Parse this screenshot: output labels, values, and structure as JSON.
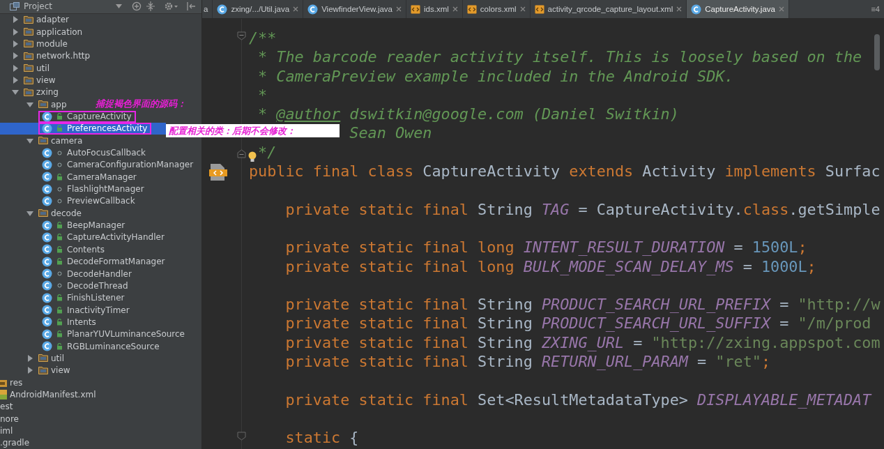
{
  "project_panel": {
    "title": "Project",
    "tree": [
      {
        "label": "adapter",
        "kind": "folder",
        "expanded": false,
        "selected": false
      },
      {
        "label": "application",
        "kind": "folder",
        "expanded": false,
        "selected": false
      },
      {
        "label": "module",
        "kind": "folder",
        "expanded": false,
        "selected": false
      },
      {
        "label": "network.http",
        "kind": "folder",
        "expanded": false,
        "selected": false
      },
      {
        "label": "util",
        "kind": "folder",
        "expanded": false,
        "selected": false
      },
      {
        "label": "view",
        "kind": "folder",
        "expanded": false,
        "selected": false
      },
      {
        "label": "zxing",
        "kind": "folder",
        "expanded": true,
        "selected": false,
        "children": [
          {
            "label": "app",
            "kind": "folder",
            "expanded": true,
            "selected": false,
            "children": [
              {
                "label": "CaptureActivity",
                "kind": "class",
                "public": true,
                "selected": false,
                "highlighted": true
              },
              {
                "label": "PreferencesActivity",
                "kind": "class",
                "public": true,
                "selected": true,
                "highlighted": true
              }
            ]
          },
          {
            "label": "camera",
            "kind": "folder",
            "expanded": true,
            "selected": false,
            "children": [
              {
                "label": "AutoFocusCallback",
                "kind": "class",
                "public": false,
                "selected": false,
                "highlighted": false
              },
              {
                "label": "CameraConfigurationManager",
                "kind": "class",
                "public": false,
                "selected": false,
                "highlighted": false
              },
              {
                "label": "CameraManager",
                "kind": "class",
                "public": true,
                "selected": false,
                "highlighted": false
              },
              {
                "label": "FlashlightManager",
                "kind": "class",
                "public": false,
                "selected": false,
                "highlighted": false
              },
              {
                "label": "PreviewCallback",
                "kind": "class",
                "public": false,
                "selected": false,
                "highlighted": false
              }
            ]
          },
          {
            "label": "decode",
            "kind": "folder",
            "expanded": true,
            "selected": false,
            "children": [
              {
                "label": "BeepManager",
                "kind": "class",
                "public": true,
                "selected": false,
                "highlighted": false
              },
              {
                "label": "CaptureActivityHandler",
                "kind": "class",
                "public": true,
                "selected": false,
                "highlighted": false
              },
              {
                "label": "Contents",
                "kind": "class",
                "public": true,
                "selected": false,
                "highlighted": false
              },
              {
                "label": "DecodeFormatManager",
                "kind": "class",
                "public": true,
                "selected": false,
                "highlighted": false
              },
              {
                "label": "DecodeHandler",
                "kind": "class",
                "public": false,
                "selected": false,
                "highlighted": false
              },
              {
                "label": "DecodeThread",
                "kind": "class",
                "public": false,
                "selected": false,
                "highlighted": false
              },
              {
                "label": "FinishListener",
                "kind": "class",
                "public": true,
                "selected": false,
                "highlighted": false
              },
              {
                "label": "InactivityTimer",
                "kind": "class",
                "public": true,
                "selected": false,
                "highlighted": false
              },
              {
                "label": "Intents",
                "kind": "class",
                "public": true,
                "selected": false,
                "highlighted": false
              },
              {
                "label": "PlanarYUVLuminanceSource",
                "kind": "class",
                "public": true,
                "selected": false,
                "highlighted": false
              },
              {
                "label": "RGBLuminanceSource",
                "kind": "class",
                "public": true,
                "selected": false,
                "highlighted": false
              }
            ]
          },
          {
            "label": "util",
            "kind": "folder",
            "expanded": false,
            "selected": false
          },
          {
            "label": "view",
            "kind": "folder",
            "expanded": false,
            "selected": false
          }
        ]
      }
    ],
    "outer_items": [
      {
        "label": "res",
        "kind": "folder"
      },
      {
        "label": "AndroidManifest.xml",
        "kind": "manifest"
      },
      {
        "label": "est",
        "kind": "cut"
      },
      {
        "label": "nore",
        "kind": "cut"
      },
      {
        "label": "iml",
        "kind": "cut"
      },
      {
        "label": ".gradle",
        "kind": "cut"
      }
    ]
  },
  "editor_tabs": {
    "tabs": [
      {
        "label": "a",
        "kind": "cut",
        "selected": false
      },
      {
        "label": "zxing/.../Util.java",
        "kind": "class",
        "selected": false
      },
      {
        "label": "ViewfinderView.java",
        "kind": "class",
        "selected": false
      },
      {
        "label": "ids.xml",
        "kind": "xml",
        "selected": false
      },
      {
        "label": "colors.xml",
        "kind": "xml",
        "selected": false
      },
      {
        "label": "activity_qrcode_capture_layout.xml",
        "kind": "xml",
        "selected": false
      },
      {
        "label": "CaptureActivity.java",
        "kind": "class",
        "selected": true
      }
    ],
    "overflow": "≡4"
  },
  "code": [
    {
      "kind": "code",
      "indented": false,
      "tokens": [
        {
          "kind": "doc",
          "t": "/**"
        }
      ]
    },
    {
      "kind": "doc_body",
      "indented": false,
      "tokens": [
        {
          "kind": "doc",
          "t": "* The barcode reader activity itself. This is loosely based on the"
        }
      ]
    },
    {
      "kind": "doc_body",
      "indented": false,
      "tokens": [
        {
          "kind": "doc",
          "t": "* CameraPreview example included in the Android SDK."
        }
      ]
    },
    {
      "kind": "doc_body",
      "indented": false,
      "tokens": [
        {
          "kind": "doc",
          "t": "*"
        }
      ]
    },
    {
      "kind": "doc_body",
      "indented": false,
      "tokens": [
        {
          "kind": "doc",
          "t": "* "
        },
        {
          "kind": "tag",
          "t": "@author"
        },
        {
          "kind": "doc",
          "t": " dswitkin@google.com (Daniel Switkin)"
        }
      ]
    },
    {
      "kind": "doc_covered",
      "indented": false,
      "tokens": [
        {
          "kind": "doc",
          "t": "Sean Owen"
        }
      ]
    },
    {
      "kind": "doc_body",
      "indented": false,
      "tokens": [
        {
          "kind": "doc",
          "t": "*/"
        }
      ]
    },
    {
      "kind": "code",
      "indented": false,
      "tokens": [
        {
          "kind": "kw",
          "t": "public final class "
        },
        {
          "kind": "id",
          "t": "CaptureActivity "
        },
        {
          "kind": "kw",
          "t": "extends "
        },
        {
          "kind": "id",
          "t": "Activity "
        },
        {
          "kind": "kw",
          "t": "implements "
        },
        {
          "kind": "id",
          "t": "Surfac"
        }
      ]
    },
    {
      "kind": "blank"
    },
    {
      "kind": "code",
      "indented": true,
      "tokens": [
        {
          "kind": "kw",
          "t": "private static final "
        },
        {
          "kind": "id",
          "t": "String "
        },
        {
          "kind": "const",
          "t": "TAG"
        },
        {
          "kind": "id",
          "t": " = CaptureActivity."
        },
        {
          "kind": "kw",
          "t": "class"
        },
        {
          "kind": "id",
          "t": ".getSimple"
        }
      ]
    },
    {
      "kind": "blank"
    },
    {
      "kind": "code",
      "indented": true,
      "tokens": [
        {
          "kind": "kw",
          "t": "private static final long "
        },
        {
          "kind": "const",
          "t": "INTENT_RESULT_DURATION"
        },
        {
          "kind": "id",
          "t": " = "
        },
        {
          "kind": "num",
          "t": "1500L"
        },
        {
          "kind": "kw",
          "t": ";"
        }
      ]
    },
    {
      "kind": "code",
      "indented": true,
      "tokens": [
        {
          "kind": "kw",
          "t": "private static final long "
        },
        {
          "kind": "const",
          "t": "BULK_MODE_SCAN_DELAY_MS"
        },
        {
          "kind": "id",
          "t": " = "
        },
        {
          "kind": "num",
          "t": "1000L"
        },
        {
          "kind": "kw",
          "t": ";"
        }
      ]
    },
    {
      "kind": "blank"
    },
    {
      "kind": "code",
      "indented": true,
      "tokens": [
        {
          "kind": "kw",
          "t": "private static final "
        },
        {
          "kind": "id",
          "t": "String "
        },
        {
          "kind": "const",
          "t": "PRODUCT_SEARCH_URL_PREFIX"
        },
        {
          "kind": "id",
          "t": " = "
        },
        {
          "kind": "str",
          "t": "\"http://w"
        }
      ]
    },
    {
      "kind": "code",
      "indented": true,
      "tokens": [
        {
          "kind": "kw",
          "t": "private static final "
        },
        {
          "kind": "id",
          "t": "String "
        },
        {
          "kind": "const",
          "t": "PRODUCT_SEARCH_URL_SUFFIX"
        },
        {
          "kind": "id",
          "t": " = "
        },
        {
          "kind": "str",
          "t": "\"/m/prod"
        }
      ]
    },
    {
      "kind": "code",
      "indented": true,
      "tokens": [
        {
          "kind": "kw",
          "t": "private static final "
        },
        {
          "kind": "id",
          "t": "String "
        },
        {
          "kind": "const",
          "t": "ZXING_URL"
        },
        {
          "kind": "id",
          "t": " = "
        },
        {
          "kind": "str",
          "t": "\"http://zxing.appspot.com"
        }
      ]
    },
    {
      "kind": "code",
      "indented": true,
      "tokens": [
        {
          "kind": "kw",
          "t": "private static final "
        },
        {
          "kind": "id",
          "t": "String "
        },
        {
          "kind": "const",
          "t": "RETURN_URL_PARAM"
        },
        {
          "kind": "id",
          "t": " = "
        },
        {
          "kind": "str",
          "t": "\"ret\""
        },
        {
          "kind": "kw",
          "t": ";"
        }
      ]
    },
    {
      "kind": "blank"
    },
    {
      "kind": "code",
      "indented": true,
      "tokens": [
        {
          "kind": "kw",
          "t": "private static final "
        },
        {
          "kind": "id",
          "t": "Set<ResultMetadataType> "
        },
        {
          "kind": "const",
          "t": "DISPLAYABLE_METADAT"
        }
      ]
    },
    {
      "kind": "blank"
    },
    {
      "kind": "code",
      "indented": true,
      "tokens": [
        {
          "kind": "kw",
          "t": "static "
        },
        {
          "kind": "id",
          "t": "{"
        }
      ]
    }
  ],
  "annotations": [
    {
      "text": "捕捉褐色界面的源码：",
      "kind": "plain"
    },
    {
      "text": "配置相关的类：后期不会修改：",
      "kind": "boxed"
    }
  ]
}
